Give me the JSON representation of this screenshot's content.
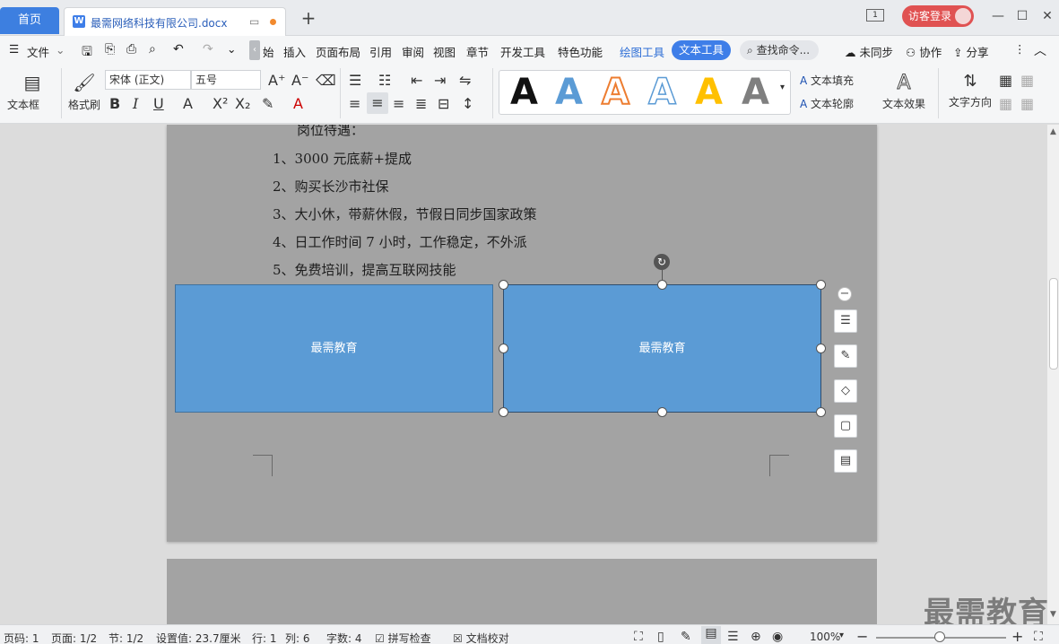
{
  "tabs": {
    "home_label": "首页",
    "doc_title": "最需网络科技有限公司.docx",
    "doc_icon": "W"
  },
  "window": {
    "login_label": "访客登录",
    "one_label": "1"
  },
  "menu": {
    "items": [
      "文件",
      "始",
      "插入",
      "页面布局",
      "引用",
      "审阅",
      "视图",
      "章节",
      "开发工具",
      "特色功能",
      "绘图工具",
      "文本工具"
    ],
    "search_placeholder": "查找命令...",
    "sync_label": "未同步",
    "collab_label": "协作",
    "share_label": "分享"
  },
  "ribbon": {
    "textbox_label": "文本框",
    "formatbrush_label": "格式刷",
    "font_name": "宋体 (正文)",
    "font_size": "五号",
    "text_fill_label": "文本填充",
    "text_outline_label": "文本轮廓",
    "text_effect_label": "文本效果",
    "text_direction_label": "文字方向",
    "gallery_letter": "A"
  },
  "document": {
    "heading_partial": "岗位待遇：",
    "lines": [
      "1、3000 元底薪+提成",
      "2、购买长沙市社保",
      "3、大小休，带薪休假，节假日同步国家政策",
      "4、日工作时间 7 小时，工作稳定，不外派",
      "5、免费培训，提高互联网技能"
    ],
    "shape_left_text": "最需教育",
    "shape_right_text": "最需教育"
  },
  "status": {
    "page_code": "页码: 1",
    "pages": "页面: 1/2",
    "section": "节: 1/2",
    "setting": "设置值: 23.7厘米",
    "row": "行: 1",
    "col": "列: 6",
    "words": "字数: 4",
    "spellcheck": "拼写检查",
    "doccheck": "文档校对",
    "zoom": "100%"
  },
  "watermark": "最需教育",
  "colors": {
    "accent": "#3e7ee8",
    "shape_fill": "#5b9bd5",
    "login": "#e05252"
  }
}
